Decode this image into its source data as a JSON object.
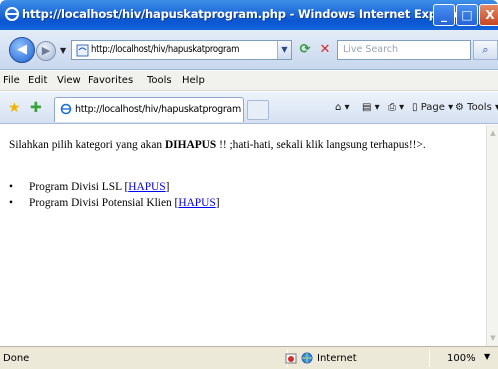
{
  "window": {
    "title": "http://localhost/hiv/hapuskatprogram.php - Windows Internet Explorer",
    "minimize_label": "_",
    "maximize_label": "□",
    "close_label": "X"
  },
  "address_bar": {
    "url": "http://localhost/hiv/hapuskatprogram",
    "search_placeholder": "Live Search"
  },
  "menu": {
    "items": [
      "File",
      "Edit",
      "View",
      "Favorites",
      "Tools",
      "Help"
    ]
  },
  "tabs": {
    "active_label": "http://localhost/hiv/hapuskatprogram...."
  },
  "toolbar": {
    "page_label": "Page",
    "tools_label": "Tools"
  },
  "content": {
    "intro_before": "Silahkan pilih kategori yang akan ",
    "intro_bold": "DIHAPUS",
    "intro_after": " !! ;hati-hati, sekali klik langsung terhapus!!>.",
    "items": [
      {
        "text": "Program Divisi LSL ",
        "bracket_open": "[",
        "link": "HAPUS",
        "bracket_close": "]"
      },
      {
        "text": "Program Divisi Potensial Klien ",
        "bracket_open": "[",
        "link": "HAPUS",
        "bracket_close": "]"
      }
    ]
  },
  "status": {
    "text": "Done",
    "zone": "Internet",
    "zoom": "100%"
  },
  "colors": {
    "titlebar": "#0a55d0",
    "link": "#0000ee"
  }
}
